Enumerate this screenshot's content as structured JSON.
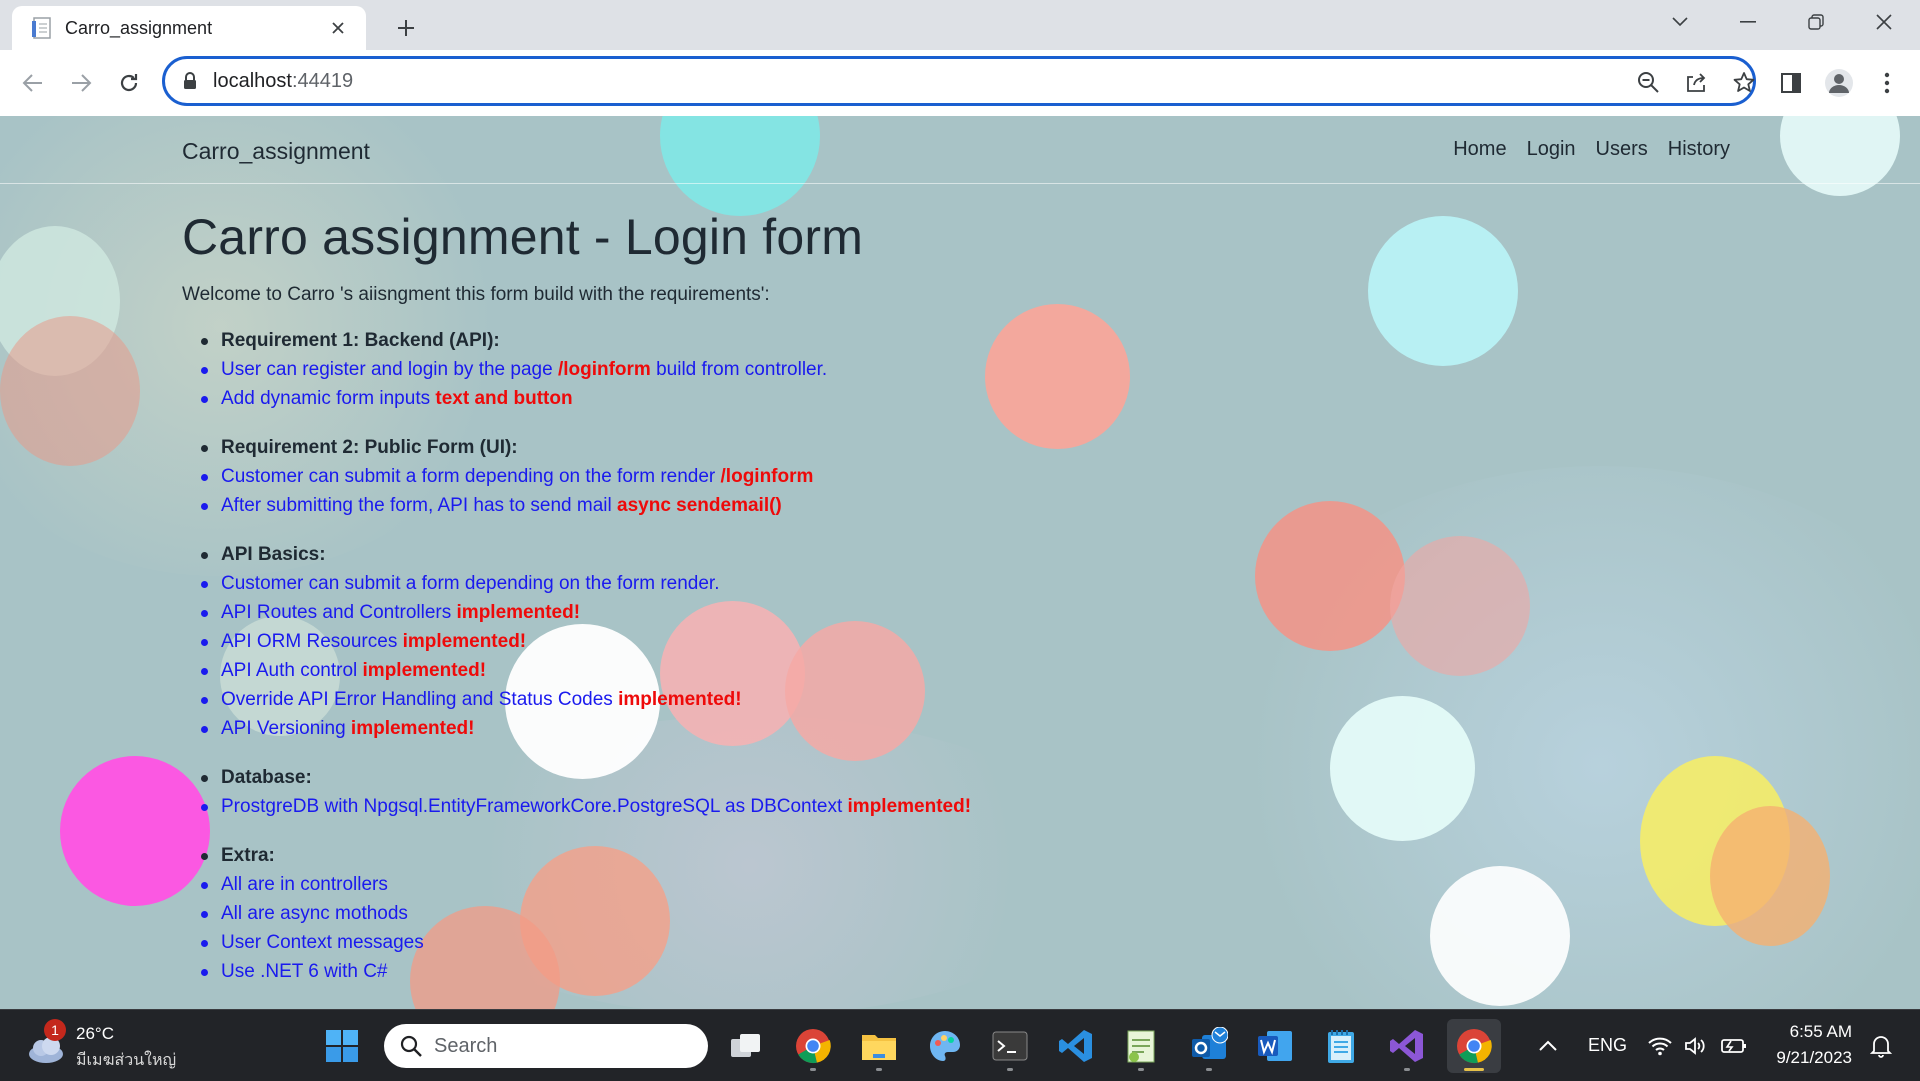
{
  "browser": {
    "tab_title": "Carro_assignment",
    "url_host": "localhost",
    "url_port": ":44419"
  },
  "site": {
    "brand": "Carro_assignment",
    "nav": [
      "Home",
      "Login",
      "Users",
      "History"
    ]
  },
  "main": {
    "heading": "Carro assignment - Login form",
    "intro": "Welcome to Carro 's aiisngment this form build with the requirements':",
    "sections": [
      {
        "title": "Requirement 1: Backend (API):",
        "items": [
          {
            "text": "User can register and login by the page ",
            "highlight": "/loginform",
            "suffix": " build from controller."
          },
          {
            "text": "Add dynamic form inputs ",
            "highlight": "text and button",
            "suffix": ""
          }
        ]
      },
      {
        "title": "Requirement 2: Public Form (UI):",
        "items": [
          {
            "text": "Customer can submit a form depending on the form render ",
            "highlight": "/loginform",
            "suffix": ""
          },
          {
            "text": "After submitting the form, API has to send mail ",
            "highlight": "async sendemail()",
            "suffix": ""
          }
        ]
      },
      {
        "title": "API Basics:",
        "items": [
          {
            "text": "Customer can submit a form depending on the form render.",
            "highlight": "",
            "suffix": ""
          },
          {
            "text": "API Routes and Controllers ",
            "highlight": "implemented!",
            "suffix": ""
          },
          {
            "text": "API ORM Resources ",
            "highlight": "implemented!",
            "suffix": ""
          },
          {
            "text": "API Auth control ",
            "highlight": "implemented!",
            "suffix": ""
          },
          {
            "text": "Override API Error Handling and Status Codes ",
            "highlight": "implemented!",
            "suffix": ""
          },
          {
            "text": "API Versioning ",
            "highlight": "implemented!",
            "suffix": ""
          }
        ]
      },
      {
        "title": "Database:",
        "items": [
          {
            "text": "ProstgreDB with Npgsql.EntityFrameworkCore.PostgreSQL as DBContext ",
            "highlight": "implemented!",
            "suffix": ""
          }
        ]
      },
      {
        "title": "Extra:",
        "items": [
          {
            "text": "All are in controllers",
            "highlight": "",
            "suffix": ""
          },
          {
            "text": "All are async mothods",
            "highlight": "",
            "suffix": ""
          },
          {
            "text": "User Context messages",
            "highlight": "",
            "suffix": ""
          },
          {
            "text": "Use .NET 6 with C#",
            "highlight": "",
            "suffix": ""
          }
        ]
      }
    ]
  },
  "taskbar": {
    "weather_temp": "26°C",
    "weather_desc": "มีเมฆส่วนใหญ่",
    "weather_badge": "1",
    "search_placeholder": "Search",
    "language": "ENG",
    "time": "6:55 AM",
    "date": "9/21/2023"
  },
  "colors": {
    "link_blue": "#1a1aee",
    "highlight_red": "#ee0a0a",
    "omnibox_focus": "#1a5fd0"
  }
}
